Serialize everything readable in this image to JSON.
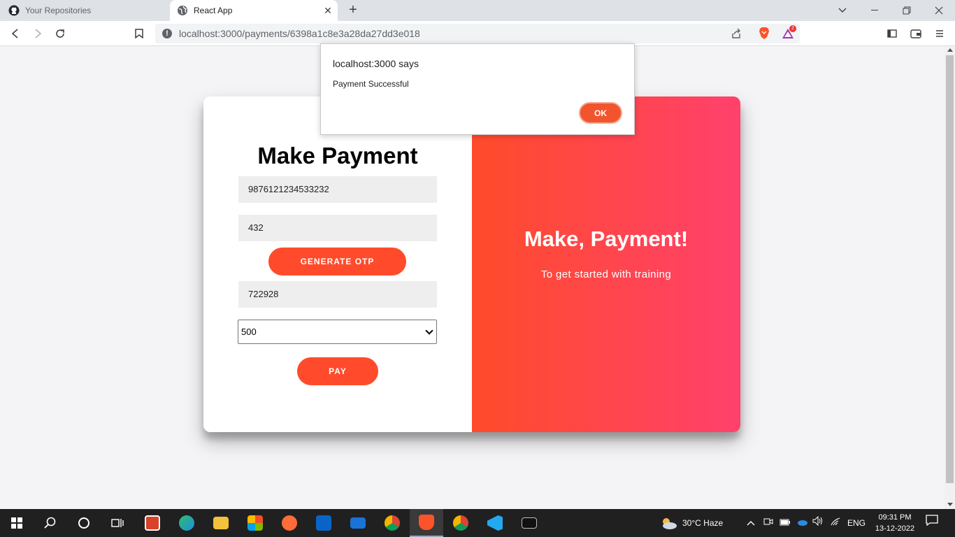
{
  "browser": {
    "tabs": [
      {
        "label": "Your Repositories",
        "icon": "github-icon"
      },
      {
        "label": "React App",
        "icon": "globe-icon"
      }
    ],
    "url": "localhost:3000/payments/6398a1c8e3a28da27dd3e018",
    "extension_badge": "2"
  },
  "dialog": {
    "title": "localhost:3000 says",
    "message": "Payment Successful",
    "ok_label": "OK"
  },
  "form": {
    "title": "Make Payment",
    "card_number": "9876121234533232",
    "cvv": "432",
    "generate_otp_label": "GENERATE OTP",
    "otp": "722928",
    "amount_selected": "500",
    "pay_label": "PAY"
  },
  "overlay": {
    "title": "Make, Payment!",
    "subtitle": "To get started with training"
  },
  "taskbar": {
    "weather": "30°C  Haze",
    "language": "ENG",
    "time": "09:31 PM",
    "date": "13-12-2022"
  },
  "colors": {
    "accent": "#ff4b2b",
    "overlay_gradient_end": "#ff416c",
    "field_bg": "#eeeeee"
  }
}
